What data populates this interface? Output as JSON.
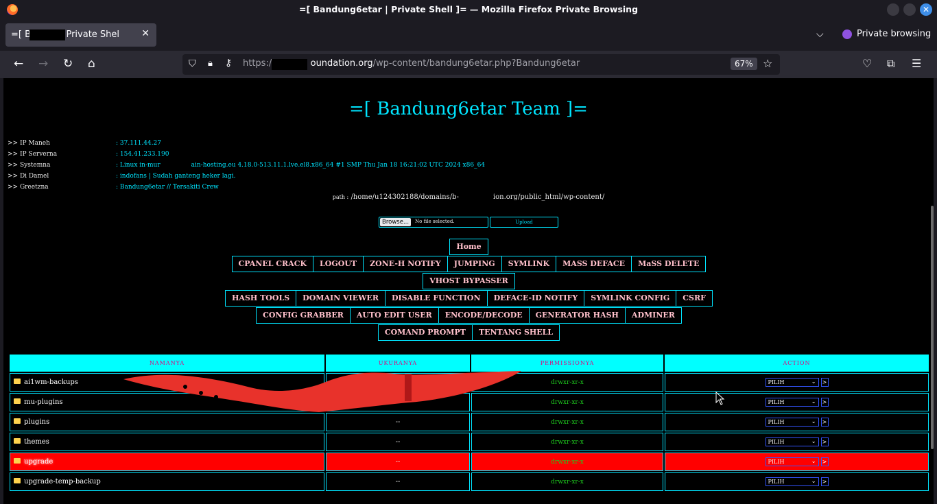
{
  "window": {
    "title": "=[ Bandung6etar | Private Shell ]= — Mozilla Firefox Private Browsing"
  },
  "tab": {
    "title": "=[ B      6etar | Private Shel"
  },
  "tabbar": {
    "private_label": "Private browsing"
  },
  "urlbar": {
    "scheme": "https://",
    "host": "oundation.org",
    "path": "/wp-content/bandung6etar.php?Bandung6etar",
    "zoom": "67%"
  },
  "page": {
    "brand": "=[ Bandung6etar Team ]=",
    "info": [
      {
        "key": ">> IP Maneh",
        "value": ": 37.111.44.27"
      },
      {
        "key": ">> IP Serverna",
        "value": ": 154.41.233.190"
      },
      {
        "key": ">> Systemna",
        "value": ": Linux in-mur",
        "value2": "ain-hosting.eu 4.18.0-513.11.1.lve.el8.x86_64 #1 SMP Thu Jan 18 16:21:02 UTC 2024 x86_64"
      },
      {
        "key": ">> Di Damel",
        "value": ": indofans | Sudah ganteng heker lagi."
      },
      {
        "key": ">> Greetzna",
        "value": ": Bandung6etar // Tersakiti Crew"
      }
    ],
    "path_label": "path :",
    "path": "/home/u124302188/domains/b-",
    "path2": "ion.org/public_html/wp-content/",
    "browse_label": "Browse...",
    "no_file": "No file selected.",
    "upload_label": "Upload",
    "menu": [
      [
        "Home"
      ],
      [
        "CPANEL CRACK",
        "LOGOUT",
        "ZONE-H NOTIFY",
        "JUMPING",
        "SYMLINK",
        "MASS DEFACE",
        "MaSS DELETE"
      ],
      [
        "VHOST BYPASSER"
      ],
      [
        "HASH TOOLS",
        "DOMAIN VIEWER",
        "DISABLE FUNCTION",
        "DEFACE-ID NOTIFY",
        "SYMLINK CONFIG",
        "CSRF"
      ],
      [
        "CONFIG GRABBER",
        "AUTO EDIT USER",
        "ENCODE/DECODE",
        "GENERATOR HASH",
        "ADMINER"
      ],
      [
        "COMAND PROMPT",
        "TENTANG SHELL"
      ]
    ],
    "table": {
      "headers": [
        "NAMANYA",
        "UKURANYA",
        "PERMISSIONYA",
        "ACTION"
      ],
      "rows": [
        {
          "name": "ai1wm-backups",
          "size": "--",
          "perm": "drwxr-xr-x",
          "action": "PILIH",
          "go": ">"
        },
        {
          "name": "mu-plugins",
          "size": "--",
          "perm": "drwxr-xr-x",
          "action": "PILIH",
          "go": ">"
        },
        {
          "name": "plugins",
          "size": "--",
          "perm": "drwxr-xr-x",
          "action": "PILIH",
          "go": ">"
        },
        {
          "name": "themes",
          "size": "--",
          "perm": "drwxr-xr-x",
          "action": "PILIH",
          "go": ">"
        },
        {
          "name": "upgrade",
          "size": "--",
          "perm": "drwxr-xr-x",
          "action": "PILIH",
          "go": ">"
        },
        {
          "name": "upgrade-temp-backup",
          "size": "--",
          "perm": "drwxr-xr-x",
          "action": "PILIH",
          "go": ">"
        }
      ],
      "highlight_row": 4
    }
  },
  "colors": {
    "accent": "#00e5ff",
    "menu_text": "#ffc0cb",
    "highlight": "#ff0000",
    "perm": "#1ecb1e"
  }
}
